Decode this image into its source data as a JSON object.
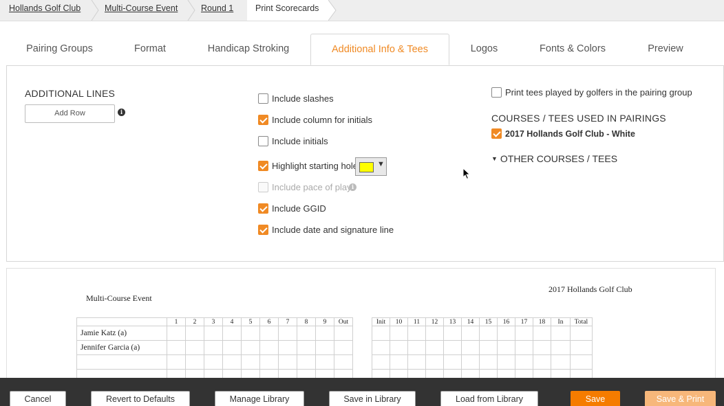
{
  "breadcrumb": {
    "items": [
      "Hollands Golf Club",
      "Multi-Course Event",
      "Round 1"
    ],
    "current": "Print Scorecards"
  },
  "tabs": [
    "Pairing Groups",
    "Format",
    "Handicap Stroking",
    "Additional Info & Tees",
    "Logos",
    "Fonts & Colors",
    "Preview"
  ],
  "active_tab": "Additional Info & Tees",
  "additional_lines": {
    "title": "ADDITIONAL LINES",
    "add_row_label": "Add Row"
  },
  "options": [
    {
      "label": "Include slashes",
      "checked": false,
      "disabled": false
    },
    {
      "label": "Include column for initials",
      "checked": true,
      "disabled": false
    },
    {
      "label": "Include initials",
      "checked": false,
      "disabled": false
    },
    {
      "label": "Highlight starting hole",
      "checked": true,
      "disabled": false
    },
    {
      "label": "Include pace of play",
      "checked": false,
      "disabled": true
    },
    {
      "label": "Include GGID",
      "checked": true,
      "disabled": false
    },
    {
      "label": "Include date and signature line",
      "checked": true,
      "disabled": false
    }
  ],
  "highlight_color": "#ffff00",
  "tees": {
    "print_tees_label": "Print tees played by golfers in the pairing group",
    "print_tees_checked": false,
    "courses_title": "COURSES / TEES USED IN PAIRINGS",
    "courses": [
      {
        "label": "2017 Hollands Golf Club - White",
        "checked": true
      }
    ],
    "other_courses_label": "OTHER COURSES / TEES"
  },
  "preview": {
    "event_name": "Multi-Course Event",
    "club_name": "2017 Hollands Golf Club",
    "front_headers": [
      "",
      "1",
      "2",
      "3",
      "4",
      "5",
      "6",
      "7",
      "8",
      "9",
      "Out"
    ],
    "back_headers": [
      "Init",
      "10",
      "11",
      "12",
      "13",
      "14",
      "15",
      "16",
      "17",
      "18",
      "In",
      "Total"
    ],
    "players": [
      "Jamie Katz (a)",
      "Jennifer Garcia (a)",
      "",
      ""
    ]
  },
  "footer": {
    "cancel": "Cancel",
    "revert": "Revert to Defaults",
    "manage_library": "Manage Library",
    "save_in_library": "Save in Library",
    "load_from_library": "Load from Library",
    "save": "Save",
    "save_print": "Save & Print"
  },
  "colors": {
    "accent": "#f08a24",
    "footer_bg": "#333333"
  }
}
